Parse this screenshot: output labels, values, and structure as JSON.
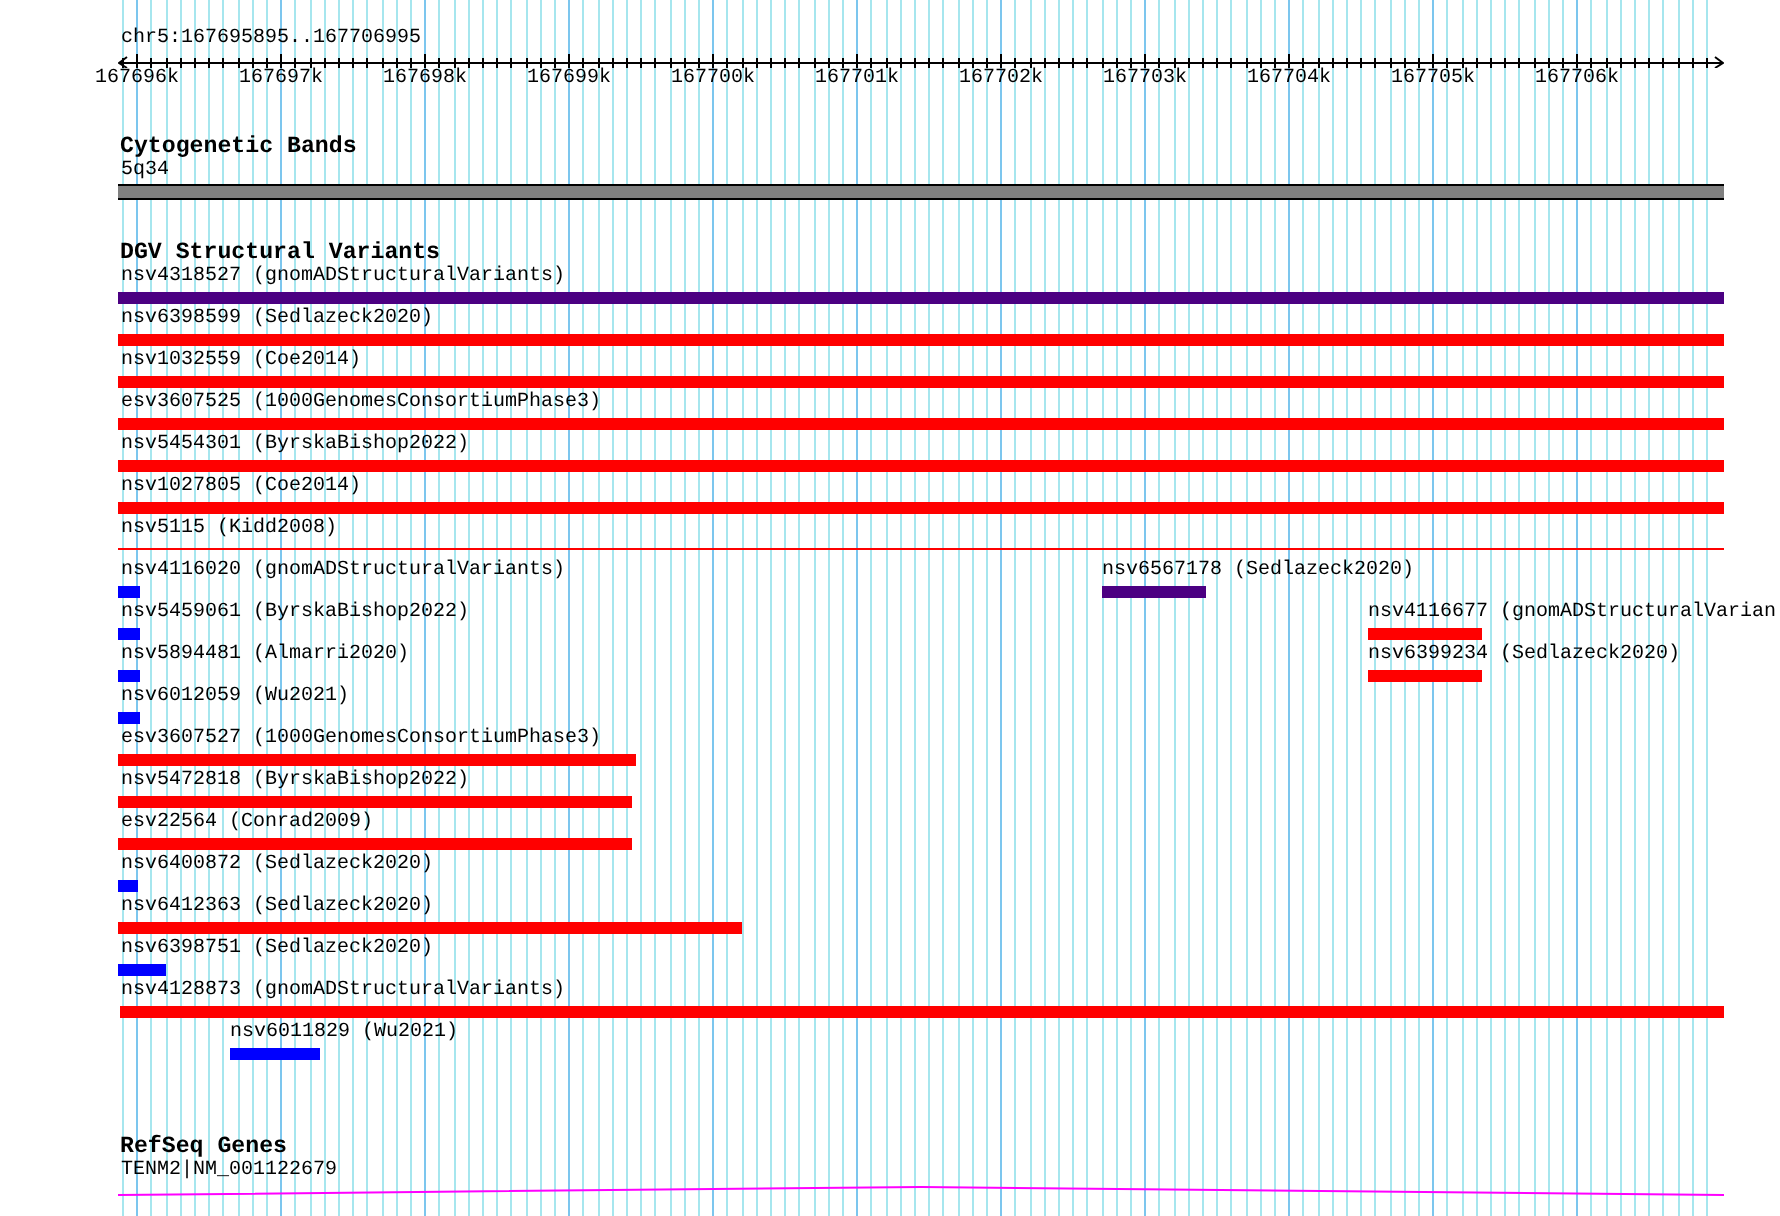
{
  "view": {
    "region": "chr5:167695895..167706995"
  },
  "ruler": {
    "ticks": [
      {
        "label": "167696k"
      },
      {
        "label": "167697k"
      },
      {
        "label": "167698k"
      },
      {
        "label": "167699k"
      },
      {
        "label": "167700k"
      },
      {
        "label": "167701k"
      },
      {
        "label": "167702k"
      },
      {
        "label": "167703k"
      },
      {
        "label": "167704k"
      },
      {
        "label": "167705k"
      },
      {
        "label": "167706k"
      }
    ]
  },
  "tracks": [
    {
      "kind": "cytoband",
      "title": "Cytogenetic Bands",
      "bands": [
        {
          "label": "5q34"
        }
      ]
    },
    {
      "kind": "features",
      "title": "DGV Structural Variants",
      "rows": [
        {
          "features": [
            {
              "label": "nsv4318527 (gnomADStructuralVariants)",
              "color": "#4b0082",
              "kind": "bar"
            }
          ]
        },
        {
          "features": [
            {
              "label": "nsv6398599 (Sedlazeck2020)",
              "color": "#ff0000",
              "kind": "bar"
            }
          ]
        },
        {
          "features": [
            {
              "label": "nsv1032559 (Coe2014)",
              "color": "#ff0000",
              "kind": "bar"
            }
          ]
        },
        {
          "features": [
            {
              "label": "esv3607525 (1000GenomesConsortiumPhase3)",
              "color": "#ff0000",
              "kind": "bar"
            }
          ]
        },
        {
          "features": [
            {
              "label": "nsv5454301 (ByrskaBishop2022)",
              "color": "#ff0000",
              "kind": "bar"
            }
          ]
        },
        {
          "features": [
            {
              "label": "nsv1027805 (Coe2014)",
              "color": "#ff0000",
              "kind": "bar"
            }
          ]
        },
        {
          "features": [
            {
              "label": "nsv5115 (Kidd2008)",
              "color": "#ff0000",
              "kind": "line"
            }
          ]
        },
        {
          "features": [
            {
              "label": "nsv4116020 (gnomADStructuralVariants)",
              "color": "#0000ff",
              "kind": "bar"
            },
            {
              "label": "nsv6567178 (Sedlazeck2020)",
              "color": "#4b0082",
              "kind": "bar"
            }
          ]
        },
        {
          "features": [
            {
              "label": "nsv5459061 (ByrskaBishop2022)",
              "color": "#0000ff",
              "kind": "bar"
            },
            {
              "label": "nsv4116677 (gnomADStructuralVarian",
              "color": "#ff0000",
              "kind": "bar"
            }
          ]
        },
        {
          "features": [
            {
              "label": "nsv5894481 (Almarri2020)",
              "color": "#0000ff",
              "kind": "bar"
            },
            {
              "label": "nsv6399234 (Sedlazeck2020)",
              "color": "#ff0000",
              "kind": "bar"
            }
          ]
        },
        {
          "features": [
            {
              "label": "nsv6012059 (Wu2021)",
              "color": "#0000ff",
              "kind": "bar"
            }
          ]
        },
        {
          "features": [
            {
              "label": "esv3607527 (1000GenomesConsortiumPhase3)",
              "color": "#ff0000",
              "kind": "bar"
            }
          ]
        },
        {
          "features": [
            {
              "label": "nsv5472818 (ByrskaBishop2022)",
              "color": "#ff0000",
              "kind": "bar"
            }
          ]
        },
        {
          "features": [
            {
              "label": "esv22564 (Conrad2009)",
              "color": "#ff0000",
              "kind": "bar"
            }
          ]
        },
        {
          "features": [
            {
              "label": "nsv6400872 (Sedlazeck2020)",
              "color": "#0000ff",
              "kind": "bar"
            }
          ]
        },
        {
          "features": [
            {
              "label": "nsv6412363 (Sedlazeck2020)",
              "color": "#ff0000",
              "kind": "bar"
            }
          ]
        },
        {
          "features": [
            {
              "label": "nsv6398751 (Sedlazeck2020)",
              "color": "#0000ff",
              "kind": "bar"
            }
          ]
        },
        {
          "features": [
            {
              "label": "nsv4128873 (gnomADStructuralVariants)",
              "color": "#ff0000",
              "kind": "bar"
            }
          ]
        },
        {
          "features": [
            {
              "label": "nsv6011829 (Wu2021)",
              "color": "#0000ff",
              "kind": "bar"
            }
          ]
        }
      ]
    },
    {
      "kind": "genes",
      "title": "RefSeq Genes",
      "genes": [
        {
          "label": "TENM2|NM_001122679"
        }
      ]
    }
  ]
}
